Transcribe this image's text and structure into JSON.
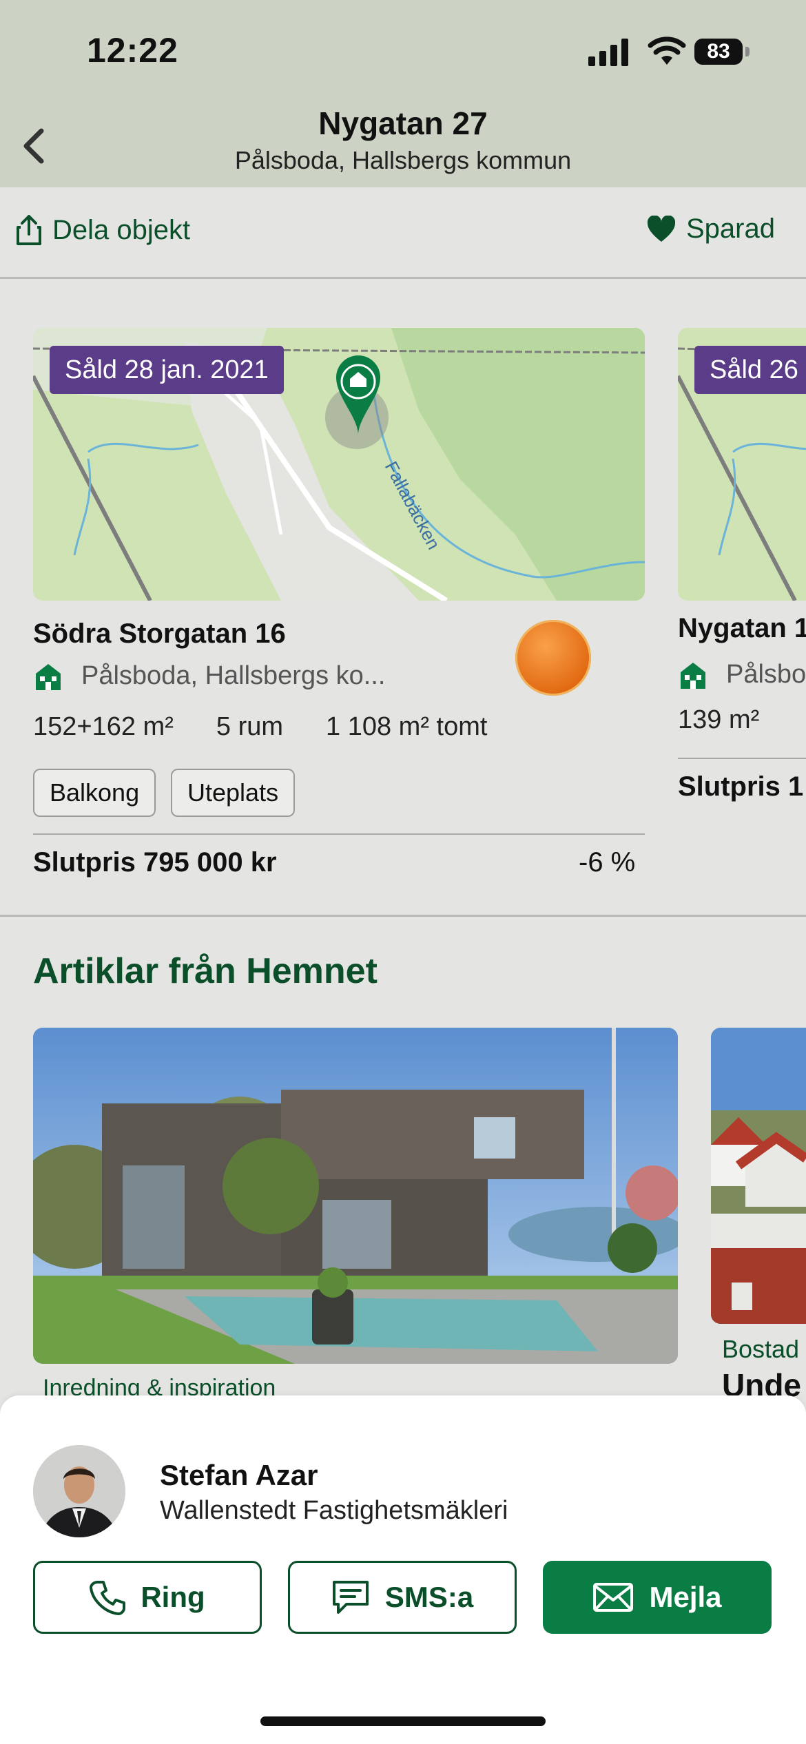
{
  "status_bar": {
    "time": "12:22",
    "battery": "83"
  },
  "header": {
    "title": "Nygatan 27",
    "subtitle": "Pålsboda, Hallsbergs kommun"
  },
  "actions": {
    "share_label": "Dela objekt",
    "saved_label": "Sparad"
  },
  "sold_cards": [
    {
      "badge": "Såld 28 jan. 2021",
      "map_label": "Fallabäcken",
      "address": "Södra Storgatan 16",
      "location": "Pålsboda, Hallsbergs ko...",
      "area": "152+162 m²",
      "rooms": "5 rum",
      "plot": "1 108 m² tomt",
      "tags": [
        "Balkong",
        "Uteplats"
      ],
      "price": "Slutpris 795 000 kr",
      "change": "-6 %"
    },
    {
      "badge": "Såld 26",
      "address": "Nygatan 1",
      "location": "Pålsbo",
      "area": "139 m²",
      "price": "Slutpris 1"
    }
  ],
  "articles": {
    "heading": "Artiklar från Hemnet",
    "items": [
      {
        "category": "Inredning & inspiration"
      },
      {
        "category": "Bostad",
        "title": "Unde"
      }
    ]
  },
  "agent": {
    "name": "Stefan Azar",
    "company": "Wallenstedt Fastighetsmäkleri",
    "call_label": "Ring",
    "sms_label": "SMS:a",
    "mail_label": "Mejla"
  },
  "colors": {
    "brand_green": "#0b4f2a",
    "accent_green": "#0a7d45",
    "sold_purple": "#5a3c88",
    "header_bg": "#cdd3c4"
  },
  "icons": [
    "back-chevron-icon",
    "share-icon",
    "heart-icon",
    "house-icon",
    "map-pin-icon",
    "phone-icon",
    "message-icon",
    "mail-icon"
  ]
}
